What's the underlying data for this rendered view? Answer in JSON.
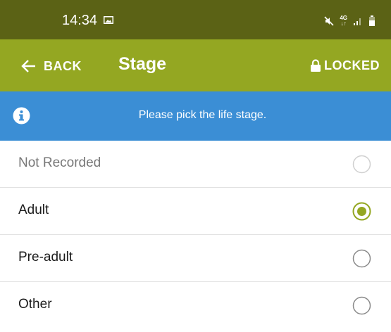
{
  "status_bar": {
    "time": "14:34",
    "network": "4G",
    "icons": [
      "gallery-icon",
      "mute-icon",
      "network-4g-icon",
      "signal-icon",
      "battery-icon"
    ]
  },
  "app_bar": {
    "back_label": "BACK",
    "title": "Stage",
    "locked_label": "LOCKED",
    "background": "#94a722"
  },
  "banner": {
    "text": "Please pick the life stage.",
    "background": "#3b8ed5"
  },
  "options": [
    {
      "label": "Not Recorded",
      "selected": false,
      "muted": true
    },
    {
      "label": "Adult",
      "selected": true,
      "muted": false
    },
    {
      "label": "Pre-adult",
      "selected": false,
      "muted": false
    },
    {
      "label": "Other",
      "selected": false,
      "muted": false
    }
  ],
  "colors": {
    "accent": "#94a722",
    "status_bar": "#5b6215",
    "radio_inactive": "#b5b5b5"
  }
}
